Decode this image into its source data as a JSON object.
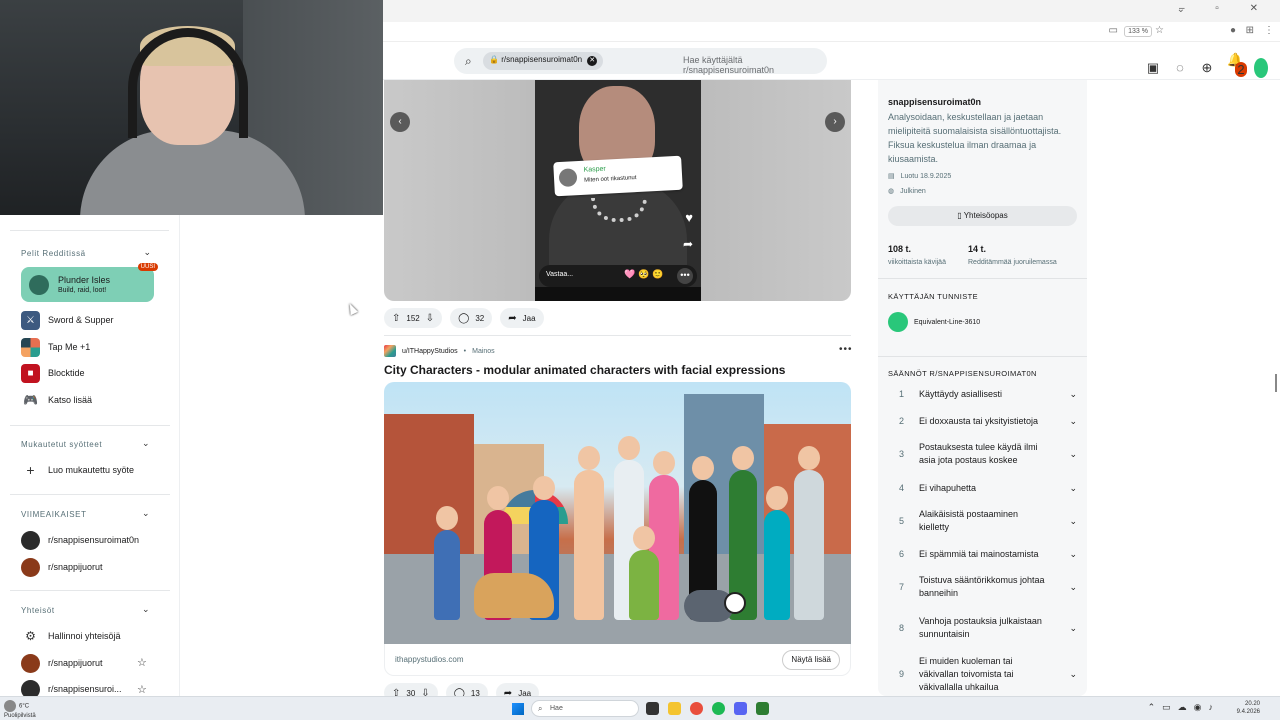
{
  "browser": {
    "zoom": "133 %",
    "window_controls": "– ▫ ✕"
  },
  "header": {
    "search_chip": "r/snappisensuroimat0n",
    "search_placeholder": "Hae käyttäjältä r/snappisensuroimat0n",
    "notif_count": "2"
  },
  "sidebar": {
    "games_section": "Pelit Redditissä",
    "featured": {
      "name": "Plunder Isles",
      "tagline": "Build, raid, loot!",
      "badge": "UUSI"
    },
    "games": [
      {
        "label": "Sword & Supper",
        "color": "#3d5a80"
      },
      {
        "label": "Tap Me +1",
        "color": "#e76f51"
      },
      {
        "label": "Blocktide",
        "color": "#c1121f"
      },
      {
        "label": "Katso lisää",
        "color": ""
      }
    ],
    "custom_section": "Mukautetut syötteet",
    "create_feed": "Luo mukautettu syöte",
    "recent_section": "VIIMEAIKAISET",
    "recent": [
      {
        "label": "r/snappisensuroimat0n",
        "color": "#2b2b2b"
      },
      {
        "label": "r/snappijuorut",
        "color": "#8a3a1a"
      }
    ],
    "communities_section": "Yhteisöt",
    "manage": "Hallinnoi yhteisöjä",
    "communities": [
      {
        "label": "r/snappijuorut",
        "color": "#8a3a1a"
      },
      {
        "label": "r/snappisensuroi...",
        "color": "#2b2b2b"
      }
    ]
  },
  "post1": {
    "reply_name": "Kasper",
    "reply_text": "Miten oot rikastunut",
    "reply_input": "Vastaa...",
    "emojis": "🩷🥺🙂",
    "votes": "152",
    "comments": "32",
    "share": "Jaa"
  },
  "post2": {
    "author": "u/ITHappyStudios",
    "tag": "Mainos",
    "title": "City Characters - modular animated characters with facial expressions",
    "domain": "ithappystudios.com",
    "cta": "Näytä lisää",
    "votes": "30",
    "comments": "13",
    "share": "Jaa"
  },
  "community": {
    "name": "snappisensuroimat0n",
    "description": "Analysoidaan, keskustellaan ja jaetaan mielipiteitä suomalaisista sisällöntuottajista. Fiksua keskustelua ilman draamaa ja kiusaamista.",
    "created": "Luotu 18.9.2025",
    "visibility": "Julkinen",
    "guide": "Yhteisöopas",
    "stat1_value": "108 t.",
    "stat1_label": "viikoittaista kävijää",
    "stat2_value": "14 t.",
    "stat2_label": "Redditämmää juoruilemassa",
    "flair_heading": "KÄYTTÄJÄN TUNNISTE",
    "flair_user": "Equivalent-Line-3610",
    "rules_heading": "SÄÄNNÖT R/SNAPPISENSUROIMAT0N",
    "rules": [
      {
        "n": "1",
        "t": "Käyttäydy asiallisesti"
      },
      {
        "n": "2",
        "t": "Ei doxxausta tai yksityistietoja"
      },
      {
        "n": "3",
        "t": "Postauksesta tulee käydä ilmi asia jota postaus koskee"
      },
      {
        "n": "4",
        "t": "Ei vihapuhetta"
      },
      {
        "n": "5",
        "t": "Alaikäisistä postaaminen kielletty"
      },
      {
        "n": "6",
        "t": "Ei spämmiä tai mainostamista"
      },
      {
        "n": "7",
        "t": "Toistuva sääntörikkomus johtaa banneihin"
      },
      {
        "n": "8",
        "t": "Vanhoja postauksia julkaistaan sunnuntaisin"
      },
      {
        "n": "9",
        "t": "Ei muiden kuoleman tai väkivallan toivomista tai väkivallalla uhkailua"
      }
    ]
  },
  "taskbar": {
    "temp": "6°C",
    "weather": "Puolipilvistä",
    "search": "Hae",
    "time": "20.20",
    "date": "9.4.2026"
  }
}
